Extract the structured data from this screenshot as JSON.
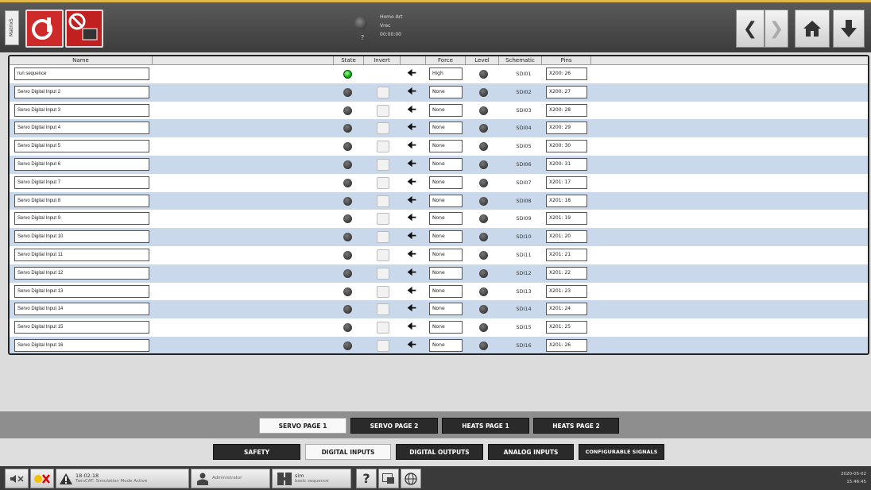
{
  "topbar": {
    "matrix_label": "MatrixS",
    "status_lines": [
      "Homo Art",
      "Vrec",
      "00:00:00"
    ],
    "status_small": "?"
  },
  "table": {
    "headers": {
      "name": "Name",
      "state": "State",
      "invert": "Invert",
      "force": "Force",
      "level": "Level",
      "schematic": "Schematic",
      "pins": "Pins"
    },
    "rows": [
      {
        "name": "run sequence",
        "state_on": true,
        "force": "High",
        "schematic": "SDI01",
        "pins": "X200: 26"
      },
      {
        "name": "Servo Digital Input 2",
        "state_on": false,
        "force": "None",
        "schematic": "SDI02",
        "pins": "X200: 27"
      },
      {
        "name": "Servo Digital Input 3",
        "state_on": false,
        "force": "None",
        "schematic": "SDI03",
        "pins": "X200: 28"
      },
      {
        "name": "Servo Digital Input 4",
        "state_on": false,
        "force": "None",
        "schematic": "SDI04",
        "pins": "X200: 29"
      },
      {
        "name": "Servo Digital Input 5",
        "state_on": false,
        "force": "None",
        "schematic": "SDI05",
        "pins": "X200: 30"
      },
      {
        "name": "Servo Digital Input 6",
        "state_on": false,
        "force": "None",
        "schematic": "SDI06",
        "pins": "X200: 31"
      },
      {
        "name": "Servo Digital Input 7",
        "state_on": false,
        "force": "None",
        "schematic": "SDI07",
        "pins": "X201: 17"
      },
      {
        "name": "Servo Digital Input 8",
        "state_on": false,
        "force": "None",
        "schematic": "SDI08",
        "pins": "X201: 18"
      },
      {
        "name": "Servo Digital Input 9",
        "state_on": false,
        "force": "None",
        "schematic": "SDI09",
        "pins": "X201: 19"
      },
      {
        "name": "Servo Digital Input 10",
        "state_on": false,
        "force": "None",
        "schematic": "SDI10",
        "pins": "X201: 20"
      },
      {
        "name": "Servo Digital Input 11",
        "state_on": false,
        "force": "None",
        "schematic": "SDI11",
        "pins": "X201: 21"
      },
      {
        "name": "Servo Digital Input 12",
        "state_on": false,
        "force": "None",
        "schematic": "SDI12",
        "pins": "X201: 22"
      },
      {
        "name": "Servo Digital Input 13",
        "state_on": false,
        "force": "None",
        "schematic": "SDI13",
        "pins": "X201: 23"
      },
      {
        "name": "Servo Digital Input 14",
        "state_on": false,
        "force": "None",
        "schematic": "SDI14",
        "pins": "X201: 24"
      },
      {
        "name": "Servo Digital Input 15",
        "state_on": false,
        "force": "None",
        "schematic": "SDI15",
        "pins": "X201: 25"
      },
      {
        "name": "Servo Digital Input 16",
        "state_on": false,
        "force": "None",
        "schematic": "SDI16",
        "pins": "X201: 26"
      }
    ]
  },
  "page_tabs": {
    "servo_page_1": "SERVO PAGE 1",
    "servo_page_2": "SERVO PAGE 2",
    "heats_page_1": "HEATS PAGE 1",
    "heats_page_2": "HEATS PAGE 2"
  },
  "category_tabs": {
    "safety": "SAFETY",
    "digital_inputs": "DIGITAL INPUTS",
    "digital_outputs": "DIGITAL OUTPUTS",
    "analog_inputs": "ANALOG INPUTS",
    "configurable_signals": "CONFIGURABLE SIGNALS"
  },
  "statusbar": {
    "alarm_time": "18:02:18",
    "alarm_text": "TwinCAT: Simulation Mode Active",
    "user": "Administrator",
    "recipe_title": "sim",
    "recipe_sub": "basic sequence",
    "help": "?",
    "date": "2020-05-02",
    "time": "15:46:45"
  },
  "colors": {
    "row_alt": "#c9d8ea",
    "accent_red": "#cf2a2a",
    "led_on": "#22aa22"
  }
}
